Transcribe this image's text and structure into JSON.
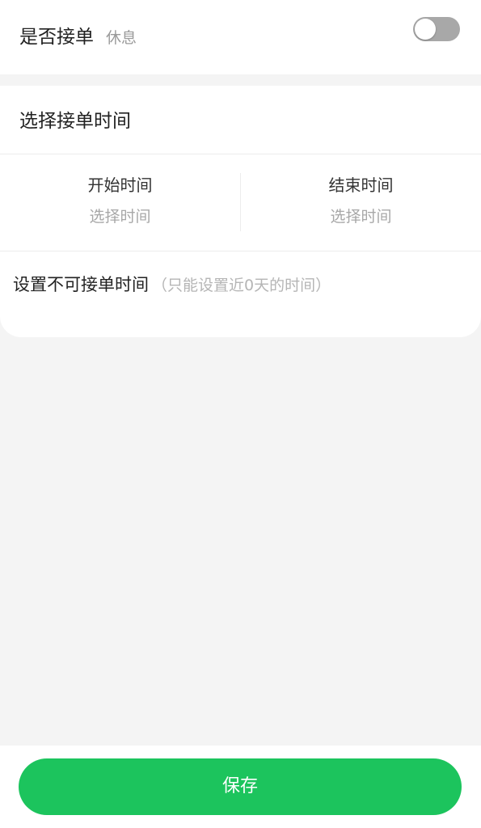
{
  "accept_orders": {
    "label": "是否接单",
    "status": "休息",
    "toggle_on": false
  },
  "order_time": {
    "title": "选择接单时间",
    "start": {
      "label": "开始时间",
      "value": "选择时间"
    },
    "end": {
      "label": "结束时间",
      "value": "选择时间"
    }
  },
  "unavailable": {
    "label": "设置不可接单时间",
    "hint": "（只能设置近0天的时间）"
  },
  "footer": {
    "save_label": "保存"
  },
  "colors": {
    "accent": "#1cc45d",
    "toggle_off": "#a8a8a8",
    "background": "#f4f4f4"
  }
}
